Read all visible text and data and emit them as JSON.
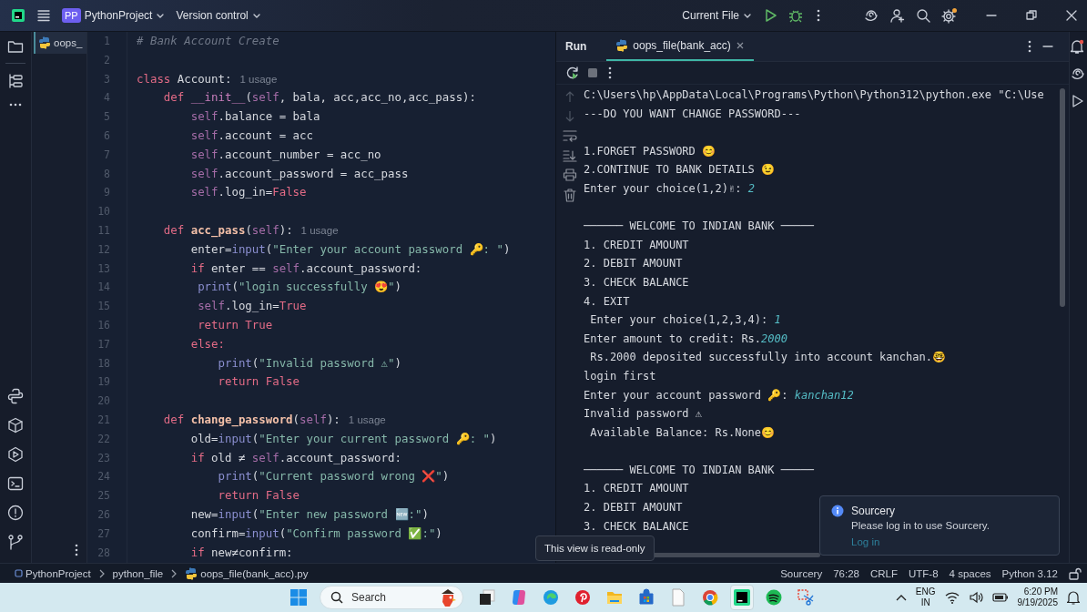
{
  "title_bar": {
    "project_badge": "PP",
    "project": "PythonProject",
    "vcs": "Version control",
    "run_config": "Current File"
  },
  "editor": {
    "tabs": [
      {
        "label": "oops_",
        "selected": true
      }
    ],
    "lines": [
      {
        "number": "1",
        "tokens": [
          {
            "text": "# Bank Account Create",
            "kind": "cmt"
          }
        ]
      },
      {
        "number": "2"
      },
      {
        "number": "3",
        "tokens": [
          {
            "text": "class ",
            "kind": "kw"
          },
          {
            "text": "Account:",
            "kind": "p"
          }
        ],
        "hint": "1 usage"
      },
      {
        "number": "4",
        "tokens": [
          {
            "text": "    def ",
            "kind": "kw"
          },
          {
            "text": "__init__",
            "kind": "dun"
          },
          {
            "text": "(",
            "kind": "p"
          },
          {
            "text": "self",
            "kind": "self"
          },
          {
            "text": ", bala, acc,acc_no,acc_pass):",
            "kind": "p"
          }
        ]
      },
      {
        "number": "5",
        "tokens": [
          {
            "text": "        self",
            "kind": "self"
          },
          {
            "text": ".balance = bala",
            "kind": "p"
          }
        ]
      },
      {
        "number": "6",
        "tokens": [
          {
            "text": "        self",
            "kind": "self"
          },
          {
            "text": ".account = acc",
            "kind": "p"
          }
        ]
      },
      {
        "number": "7",
        "tokens": [
          {
            "text": "        self",
            "kind": "self"
          },
          {
            "text": ".account_number = acc_no",
            "kind": "p"
          }
        ]
      },
      {
        "number": "8",
        "tokens": [
          {
            "text": "        self",
            "kind": "self"
          },
          {
            "text": ".account_password = acc_pass",
            "kind": "p"
          }
        ]
      },
      {
        "number": "9",
        "tokens": [
          {
            "text": "        self",
            "kind": "self"
          },
          {
            "text": ".log_in=",
            "kind": "p"
          },
          {
            "text": "False",
            "kind": "kw"
          }
        ]
      },
      {
        "number": "10"
      },
      {
        "number": "11",
        "tokens": [
          {
            "text": "    def ",
            "kind": "kw"
          },
          {
            "text": "acc_pass",
            "kind": "fn"
          },
          {
            "text": "(",
            "kind": "p"
          },
          {
            "text": "self",
            "kind": "self"
          },
          {
            "text": "):",
            "kind": "p"
          }
        ],
        "hint": "1 usage"
      },
      {
        "number": "12",
        "tokens": [
          {
            "text": "        enter=",
            "kind": "p"
          },
          {
            "text": "input",
            "kind": "bi"
          },
          {
            "text": "(",
            "kind": "p"
          },
          {
            "text": "\"Enter your account password 🔑: \"",
            "kind": "str"
          },
          {
            "text": ")",
            "kind": "p"
          }
        ]
      },
      {
        "number": "13",
        "tokens": [
          {
            "text": "        if ",
            "kind": "kw"
          },
          {
            "text": "enter == ",
            "kind": "p"
          },
          {
            "text": "self",
            "kind": "self"
          },
          {
            "text": ".account_password:",
            "kind": "p"
          }
        ]
      },
      {
        "number": "14",
        "tokens": [
          {
            "text": "         print",
            "kind": "bi"
          },
          {
            "text": "(",
            "kind": "p"
          },
          {
            "text": "\"login successfully 😍\"",
            "kind": "str"
          },
          {
            "text": ")",
            "kind": "p"
          }
        ]
      },
      {
        "number": "15",
        "tokens": [
          {
            "text": "         self",
            "kind": "self"
          },
          {
            "text": ".log_in=",
            "kind": "p"
          },
          {
            "text": "True",
            "kind": "kw"
          }
        ]
      },
      {
        "number": "16",
        "tokens": [
          {
            "text": "         return True",
            "kind": "kw"
          }
        ]
      },
      {
        "number": "17",
        "tokens": [
          {
            "text": "        else:",
            "kind": "kw"
          }
        ]
      },
      {
        "number": "18",
        "tokens": [
          {
            "text": "            print",
            "kind": "bi"
          },
          {
            "text": "(",
            "kind": "p"
          },
          {
            "text": "\"Invalid password ⚠\"",
            "kind": "str"
          },
          {
            "text": ")",
            "kind": "p"
          }
        ]
      },
      {
        "number": "19",
        "tokens": [
          {
            "text": "            return False",
            "kind": "kw"
          }
        ]
      },
      {
        "number": "20"
      },
      {
        "number": "21",
        "tokens": [
          {
            "text": "    def ",
            "kind": "kw"
          },
          {
            "text": "change_password",
            "kind": "fn"
          },
          {
            "text": "(",
            "kind": "p"
          },
          {
            "text": "self",
            "kind": "self"
          },
          {
            "text": "):",
            "kind": "p"
          }
        ],
        "hint": "1 usage"
      },
      {
        "number": "22",
        "tokens": [
          {
            "text": "        old=",
            "kind": "p"
          },
          {
            "text": "input",
            "kind": "bi"
          },
          {
            "text": "(",
            "kind": "p"
          },
          {
            "text": "\"Enter your current password 🔑: \"",
            "kind": "str"
          },
          {
            "text": ")",
            "kind": "p"
          }
        ]
      },
      {
        "number": "23",
        "tokens": [
          {
            "text": "        if ",
            "kind": "kw"
          },
          {
            "text": "old ≠ ",
            "kind": "p"
          },
          {
            "text": "self",
            "kind": "self"
          },
          {
            "text": ".account_password:",
            "kind": "p"
          }
        ]
      },
      {
        "number": "24",
        "tokens": [
          {
            "text": "            print",
            "kind": "bi"
          },
          {
            "text": "(",
            "kind": "p"
          },
          {
            "text": "\"Current password wrong ❌\"",
            "kind": "str"
          },
          {
            "text": ")",
            "kind": "p"
          }
        ]
      },
      {
        "number": "25",
        "tokens": [
          {
            "text": "            return False",
            "kind": "kw"
          }
        ]
      },
      {
        "number": "26",
        "tokens": [
          {
            "text": "        new=",
            "kind": "p"
          },
          {
            "text": "input",
            "kind": "bi"
          },
          {
            "text": "(",
            "kind": "p"
          },
          {
            "text": "\"Enter new password 🆕:\"",
            "kind": "str"
          },
          {
            "text": ")",
            "kind": "p"
          }
        ]
      },
      {
        "number": "27",
        "tokens": [
          {
            "text": "        confirm=",
            "kind": "p"
          },
          {
            "text": "input",
            "kind": "bi"
          },
          {
            "text": "(",
            "kind": "p"
          },
          {
            "text": "\"Confirm password ✅:\"",
            "kind": "str"
          },
          {
            "text": ")",
            "kind": "p"
          }
        ]
      },
      {
        "number": "28",
        "tokens": [
          {
            "text": "        if ",
            "kind": "kw"
          },
          {
            "text": "new≠confirm:",
            "kind": "p"
          }
        ]
      }
    ]
  },
  "run_panel": {
    "title": "Run",
    "tabs": [
      {
        "label": "oops_file(bank_acc)",
        "selected": true
      }
    ],
    "console": [
      {
        "kind": "text",
        "tokens": [
          {
            "text": "C:\\Users\\hp\\AppData\\Local\\Programs\\Python\\Python312\\python.exe \"C:\\Use",
            "kind": "out"
          }
        ]
      },
      {
        "kind": "text",
        "tokens": [
          {
            "text": "---DO YOU WANT CHANGE PASSWORD---",
            "kind": "out"
          }
        ]
      },
      {
        "kind": "blank"
      },
      {
        "kind": "text",
        "tokens": [
          {
            "text": "1.FORGET PASSWORD 😊",
            "kind": "out"
          }
        ]
      },
      {
        "kind": "text",
        "tokens": [
          {
            "text": "2.CONTINUE TO BANK DETAILS 😉",
            "kind": "out"
          }
        ]
      },
      {
        "kind": "text",
        "tokens": [
          {
            "text": "Enter your choice(1,2)✌: ",
            "kind": "out"
          },
          {
            "text": "2",
            "kind": "in"
          }
        ]
      },
      {
        "kind": "blank"
      },
      {
        "kind": "text",
        "tokens": [
          {
            "text": "────── WELCOME TO INDIAN BANK ─────",
            "kind": "out"
          }
        ]
      },
      {
        "kind": "text",
        "tokens": [
          {
            "text": "1. CREDIT AMOUNT",
            "kind": "out"
          }
        ]
      },
      {
        "kind": "text",
        "tokens": [
          {
            "text": "2. DEBIT AMOUNT",
            "kind": "out"
          }
        ]
      },
      {
        "kind": "text",
        "tokens": [
          {
            "text": "3. CHECK BALANCE",
            "kind": "out"
          }
        ]
      },
      {
        "kind": "text",
        "tokens": [
          {
            "text": "4. EXIT",
            "kind": "out"
          }
        ]
      },
      {
        "kind": "text",
        "tokens": [
          {
            "text": " Enter your choice(1,2,3,4): ",
            "kind": "out"
          },
          {
            "text": "1",
            "kind": "in"
          }
        ]
      },
      {
        "kind": "text",
        "tokens": [
          {
            "text": "Enter amount to credit: Rs.",
            "kind": "out"
          },
          {
            "text": "2000",
            "kind": "in"
          }
        ]
      },
      {
        "kind": "text",
        "tokens": [
          {
            "text": " Rs.2000 deposited successfully into account kanchan.🤓",
            "kind": "out"
          }
        ]
      },
      {
        "kind": "text",
        "tokens": [
          {
            "text": "login first",
            "kind": "out"
          }
        ]
      },
      {
        "kind": "text",
        "tokens": [
          {
            "text": "Enter your account password 🔑: ",
            "kind": "out"
          },
          {
            "text": "kanchan12",
            "kind": "in"
          }
        ]
      },
      {
        "kind": "text",
        "tokens": [
          {
            "text": "Invalid password ⚠",
            "kind": "out"
          }
        ]
      },
      {
        "kind": "text",
        "tokens": [
          {
            "text": " Available Balance: Rs.None😊",
            "kind": "out"
          }
        ]
      },
      {
        "kind": "blank"
      },
      {
        "kind": "text",
        "tokens": [
          {
            "text": "────── WELCOME TO INDIAN BANK ─────",
            "kind": "out"
          }
        ]
      },
      {
        "kind": "text",
        "tokens": [
          {
            "text": "1. CREDIT AMOUNT",
            "kind": "out"
          }
        ]
      },
      {
        "kind": "text",
        "tokens": [
          {
            "text": "2. DEBIT AMOUNT",
            "kind": "out"
          }
        ]
      },
      {
        "kind": "text",
        "tokens": [
          {
            "text": "3. CHECK BALANCE",
            "kind": "out"
          }
        ]
      }
    ]
  },
  "tooltip": "This view is read-only",
  "notification": {
    "title": "Sourcery",
    "message": "Please log in to use Sourcery.",
    "link": "Log in"
  },
  "status_bar": {
    "breadcrumbs": [
      "PythonProject",
      "python_file",
      "oops_file(bank_acc).py"
    ],
    "items": [
      "Sourcery",
      "76:28",
      "CRLF",
      "UTF-8",
      "4 spaces",
      "Python 3.12"
    ]
  },
  "taskbar": {
    "search_placeholder": "Search",
    "apps": [
      {
        "selected": false
      },
      {
        "selected": false
      },
      {
        "selected": false
      },
      {
        "selected": false
      },
      {
        "selected": false
      },
      {
        "selected": false
      },
      {
        "selected": false
      },
      {
        "selected": false
      },
      {
        "selected": true
      },
      {
        "selected": false
      },
      {
        "selected": false
      }
    ],
    "language": "ENG",
    "region": "IN",
    "time": "6:20 PM",
    "date": "9/19/2025"
  }
}
